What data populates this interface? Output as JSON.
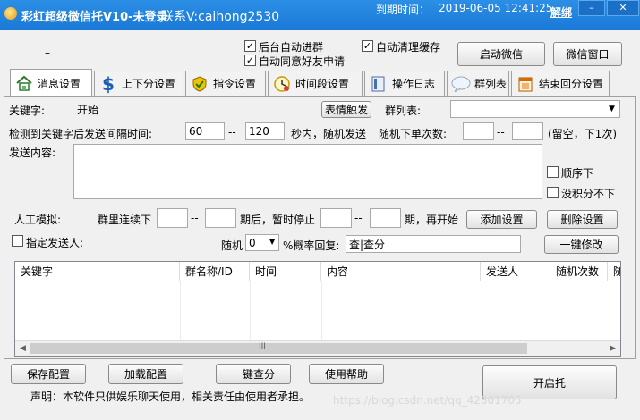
{
  "titlebar": {
    "app_title": "彩虹超级微信托V10-未登录",
    "contact": "联系V:caihong2530",
    "expire_label": "到期时间：",
    "expire_value": "2019-06-05 12:41:25",
    "unbind": "解绑",
    "minimize": "–",
    "close": "✕"
  },
  "top": {
    "dash": "–",
    "auto_accept": "后台自动进群",
    "auto_add_friend": "自动同意好友申请",
    "auto_clear": "自动清理缓存",
    "start_wechat": "启动微信",
    "wechat_window": "微信窗口",
    "check": "✓"
  },
  "tabs": [
    {
      "label": "消息设置",
      "icon": "home-icon"
    },
    {
      "label": "上下分设置",
      "icon": "dollar-icon"
    },
    {
      "label": "指令设置",
      "icon": "shield-check-icon"
    },
    {
      "label": "时间段设置",
      "icon": "clock-icon"
    },
    {
      "label": "操作日志",
      "icon": "log-icon"
    },
    {
      "label": "群列表",
      "icon": "chat-bubble-icon"
    },
    {
      "label": "结束回分设置",
      "icon": "calendar-icon"
    }
  ],
  "form": {
    "keyword_label": "关键字:",
    "keyword_value": "开始",
    "emoji_button": "表情触发",
    "group_list_label": "群列表:",
    "group_list_value": "",
    "interval_label": "检测到关键字后发送间隔时间:",
    "interval_min": "60",
    "interval_sep": "--",
    "interval_max": "120",
    "interval_unit": "秒内，随机发送",
    "random_count_label": "随机下单次数:",
    "random_count_min": "",
    "random_count_sep": "--",
    "random_count_max": "",
    "random_count_hint": "(留空，下1次)",
    "content_label": "发送内容:",
    "content_value": "",
    "sequential": "顺序下",
    "no_points": "没积分不下",
    "manual_label": "人工模拟:",
    "group_continuous": "群里连续下",
    "manual_sep1": "--",
    "after_pause": "期后，暂时停止",
    "manual_sep2": "--",
    "then_start": "期，再开始",
    "add_setting": "添加设置",
    "delete_setting": "删除设置",
    "specify_sender": "指定发送人:",
    "random_label": "随机",
    "random_value": "0",
    "prob_reply": "%概率回复:",
    "prob_reply_value": "查|查分",
    "one_key_modify": "一键修改"
  },
  "table": {
    "columns": [
      "关键字",
      "群名称/ID",
      "时间",
      "内容",
      "发送人",
      "随机次数",
      "随"
    ],
    "scroll_mid": "III",
    "scroll_left": "◀",
    "scroll_right": "▶"
  },
  "bottom": {
    "save": "保存配置",
    "load": "加载配置",
    "query": "一键查分",
    "help": "使用帮助",
    "start": "开启托",
    "disclaimer": "声明：本软件只供娱乐聊天使用，相关责任由使用者承担。",
    "watermark": "https://blog.csdn.net/qq_42801705"
  }
}
